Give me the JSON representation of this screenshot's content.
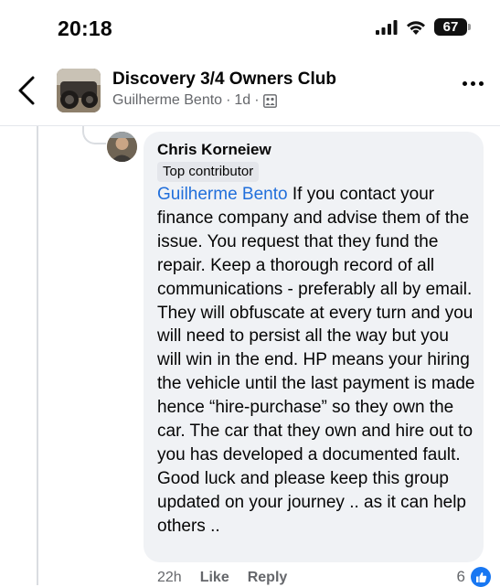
{
  "status_bar": {
    "time": "20:18",
    "battery": "67"
  },
  "header": {
    "group_name": "Discovery 3/4 Owners Club",
    "author": "Guilherme Bento",
    "separator": "·",
    "age": "1d",
    "separator2": "·"
  },
  "comment": {
    "author": "Chris Korneiew",
    "badge": "Top contributor",
    "mention": "Guilherme Bento",
    "body": " If you contact your finance company and advise them of the issue. You request that they fund the repair. Keep a thorough record of all communications - preferably all by email.  They will obfuscate at every turn and you will need to persist all the way but you will win in the end.  HP means your hiring the vehicle until the last payment is made  hence “hire-purchase” so they own the car. The car that they own and hire out to you has developed a documented fault.  Good luck and please keep this group updated on your journey .. as it can help others ..",
    "time": "22h",
    "like_label": "Like",
    "reply_label": "Reply",
    "reaction_count": "6"
  }
}
